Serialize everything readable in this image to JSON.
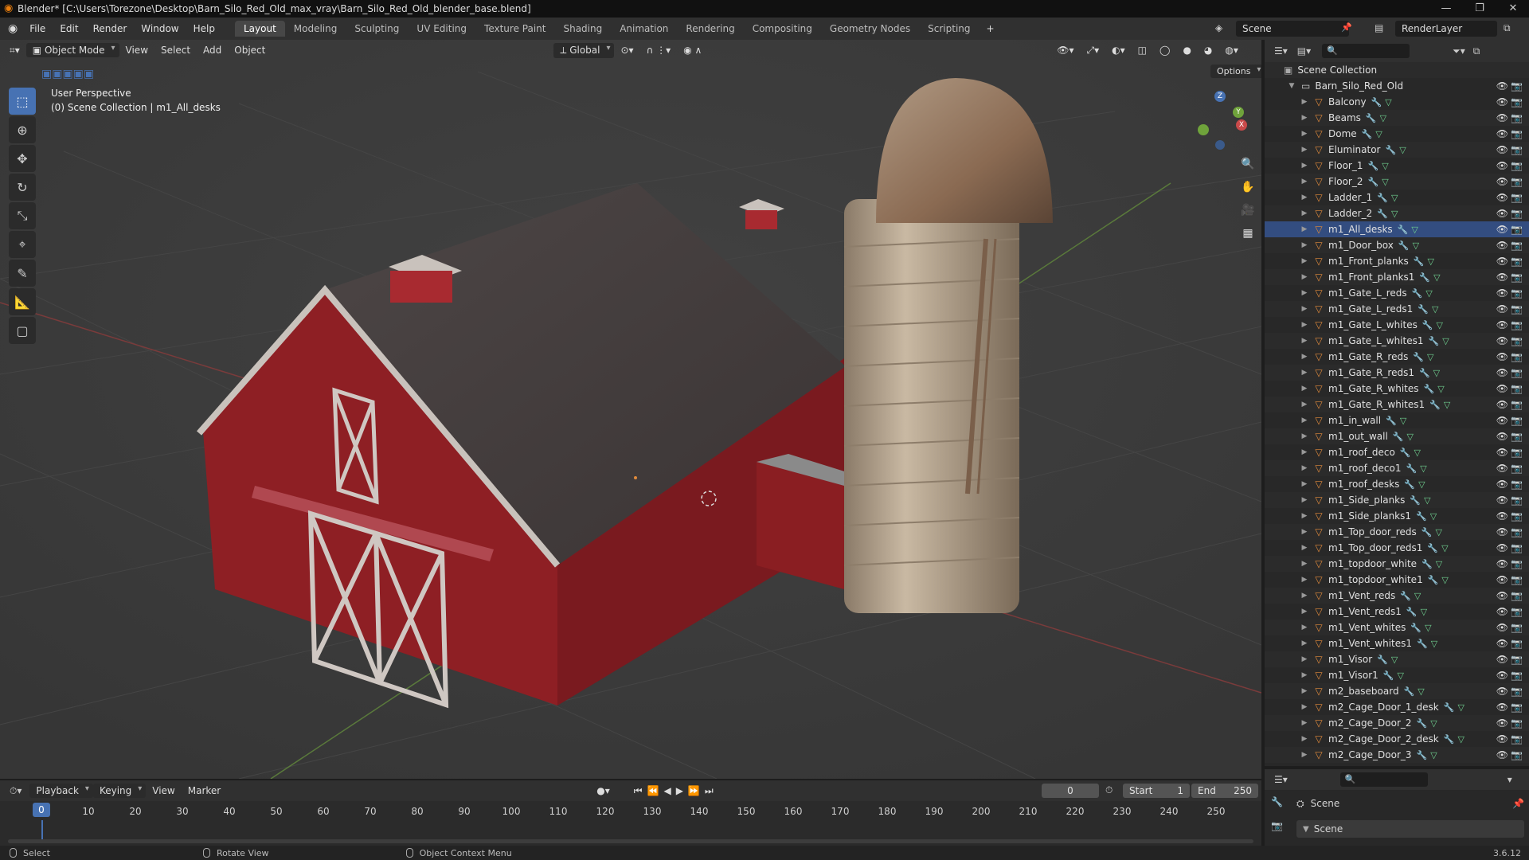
{
  "titlebar": {
    "title": "Blender* [C:\\Users\\Torezone\\Desktop\\Barn_Silo_Red_Old_max_vray\\Barn_Silo_Red_Old_blender_base.blend]"
  },
  "menu": {
    "items": [
      "File",
      "Edit",
      "Render",
      "Window",
      "Help"
    ],
    "workspaces": [
      "Layout",
      "Modeling",
      "Sculpting",
      "UV Editing",
      "Texture Paint",
      "Shading",
      "Animation",
      "Rendering",
      "Compositing",
      "Geometry Nodes",
      "Scripting"
    ],
    "active_workspace": "Layout",
    "add_workspace": "+",
    "scene_name": "Scene",
    "view_layer": "RenderLayer"
  },
  "viewport": {
    "mode": "Object Mode",
    "menus": [
      "View",
      "Select",
      "Add",
      "Object"
    ],
    "transform_orientation": "Global",
    "options_label": "Options",
    "overlay_title": "User Perspective",
    "overlay_subtitle": "(0) Scene Collection | m1_All_desks",
    "gizmo_axes": {
      "z": "Z",
      "y": "Y",
      "x": "X"
    }
  },
  "outliner": {
    "root": "Scene Collection",
    "collection": "Barn_Silo_Red_Old",
    "selected": "m1_All_desks",
    "items": [
      "Balcony",
      "Beams",
      "Dome",
      "Eluminator",
      "Floor_1",
      "Floor_2",
      "Ladder_1",
      "Ladder_2",
      "m1_All_desks",
      "m1_Door_box",
      "m1_Front_planks",
      "m1_Front_planks1",
      "m1_Gate_L_reds",
      "m1_Gate_L_reds1",
      "m1_Gate_L_whites",
      "m1_Gate_L_whites1",
      "m1_Gate_R_reds",
      "m1_Gate_R_reds1",
      "m1_Gate_R_whites",
      "m1_Gate_R_whites1",
      "m1_in_wall",
      "m1_out_wall",
      "m1_roof_deco",
      "m1_roof_deco1",
      "m1_roof_desks",
      "m1_Side_planks",
      "m1_Side_planks1",
      "m1_Top_door_reds",
      "m1_Top_door_reds1",
      "m1_topdoor_white",
      "m1_topdoor_white1",
      "m1_Vent_reds",
      "m1_Vent_reds1",
      "m1_Vent_whites",
      "m1_Vent_whites1",
      "m1_Visor",
      "m1_Visor1",
      "m2_baseboard",
      "m2_Cage_Door_1_desk",
      "m2_Cage_Door_2",
      "m2_Cage_Door_2_desk",
      "m2_Cage_Door_3"
    ]
  },
  "properties": {
    "scene_label": "Scene",
    "panel_label": "Scene",
    "version": "3.6.12"
  },
  "timeline": {
    "menus": [
      "Playback",
      "Keying",
      "View",
      "Marker"
    ],
    "current_frame": "0",
    "start_label": "Start",
    "start": "1",
    "end_label": "End",
    "end": "250",
    "ticks": [
      "0",
      "10",
      "20",
      "30",
      "40",
      "50",
      "60",
      "70",
      "80",
      "90",
      "100",
      "110",
      "120",
      "130",
      "140",
      "150",
      "160",
      "170",
      "180",
      "190",
      "200",
      "210",
      "220",
      "230",
      "240",
      "250"
    ]
  },
  "statusbar": {
    "items": [
      "Select",
      "Rotate View",
      "Object Context Menu"
    ]
  }
}
